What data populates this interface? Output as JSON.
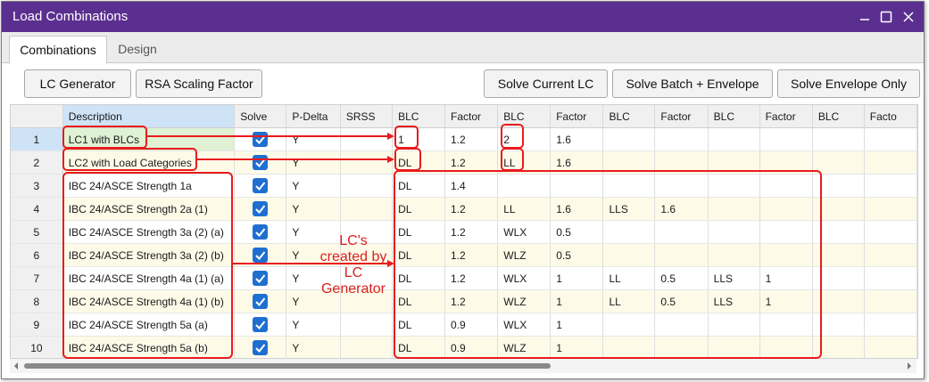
{
  "window": {
    "title": "Load Combinations",
    "title_bar_color": "#5b2f90",
    "controls": {
      "minimize": "minimize-icon",
      "maximize": "maximize-icon",
      "close": "close-icon"
    }
  },
  "tabs": [
    {
      "label": "Combinations",
      "active": true
    },
    {
      "label": "Design",
      "active": false
    }
  ],
  "toolbar": {
    "lc_generator": "LC Generator",
    "rsa_scaling": "RSA Scaling Factor",
    "solve_current": "Solve Current LC",
    "solve_batch": "Solve Batch + Envelope",
    "solve_envelope": "Solve Envelope Only"
  },
  "grid": {
    "headers": [
      "Description",
      "Solve",
      "P-Delta",
      "SRSS",
      "BLC",
      "Factor",
      "BLC",
      "Factor",
      "BLC",
      "Factor",
      "BLC",
      "Factor",
      "BLC",
      "Facto"
    ],
    "rows": [
      {
        "num": "1",
        "description": "LC1 with BLCs",
        "pdelta": "Y",
        "srss": "",
        "cells": [
          "1",
          "1.2",
          "2",
          "1.6",
          "",
          "",
          "",
          "",
          "",
          ""
        ]
      },
      {
        "num": "2",
        "description": "LC2 with Load Categories",
        "pdelta": "Y",
        "srss": "",
        "cells": [
          "DL",
          "1.2",
          "LL",
          "1.6",
          "",
          "",
          "",
          "",
          "",
          ""
        ]
      },
      {
        "num": "3",
        "description": "IBC 24/ASCE Strength 1a",
        "pdelta": "Y",
        "srss": "",
        "cells": [
          "DL",
          "1.4",
          "",
          "",
          "",
          "",
          "",
          "",
          "",
          ""
        ]
      },
      {
        "num": "4",
        "description": "IBC 24/ASCE Strength 2a (1)",
        "pdelta": "Y",
        "srss": "",
        "cells": [
          "DL",
          "1.2",
          "LL",
          "1.6",
          "LLS",
          "1.6",
          "",
          "",
          "",
          ""
        ]
      },
      {
        "num": "5",
        "description": "IBC 24/ASCE Strength 3a (2) (a)",
        "pdelta": "Y",
        "srss": "",
        "cells": [
          "DL",
          "1.2",
          "WLX",
          "0.5",
          "",
          "",
          "",
          "",
          "",
          ""
        ]
      },
      {
        "num": "6",
        "description": "IBC 24/ASCE Strength 3a (2) (b)",
        "pdelta": "Y",
        "srss": "",
        "cells": [
          "DL",
          "1.2",
          "WLZ",
          "0.5",
          "",
          "",
          "",
          "",
          "",
          ""
        ]
      },
      {
        "num": "7",
        "description": "IBC 24/ASCE Strength 4a (1) (a)",
        "pdelta": "Y",
        "srss": "",
        "cells": [
          "DL",
          "1.2",
          "WLX",
          "1",
          "LL",
          "0.5",
          "LLS",
          "1",
          "",
          ""
        ]
      },
      {
        "num": "8",
        "description": "IBC 24/ASCE Strength 4a (1) (b)",
        "pdelta": "Y",
        "srss": "",
        "cells": [
          "DL",
          "1.2",
          "WLZ",
          "1",
          "LL",
          "0.5",
          "LLS",
          "1",
          "",
          ""
        ]
      },
      {
        "num": "9",
        "description": "IBC 24/ASCE Strength 5a (a)",
        "pdelta": "Y",
        "srss": "",
        "cells": [
          "DL",
          "0.9",
          "WLX",
          "1",
          "",
          "",
          "",
          "",
          "",
          ""
        ]
      },
      {
        "num": "10",
        "description": "IBC 24/ASCE Strength 5a (b)",
        "pdelta": "Y",
        "srss": "",
        "cells": [
          "DL",
          "0.9",
          "WLZ",
          "1",
          "",
          "",
          "",
          "",
          "",
          ""
        ]
      }
    ]
  },
  "annotation": {
    "line1": "LC's",
    "line2": "created by",
    "line3": "LC",
    "line4": "Generator",
    "color": "#e81c1c"
  }
}
